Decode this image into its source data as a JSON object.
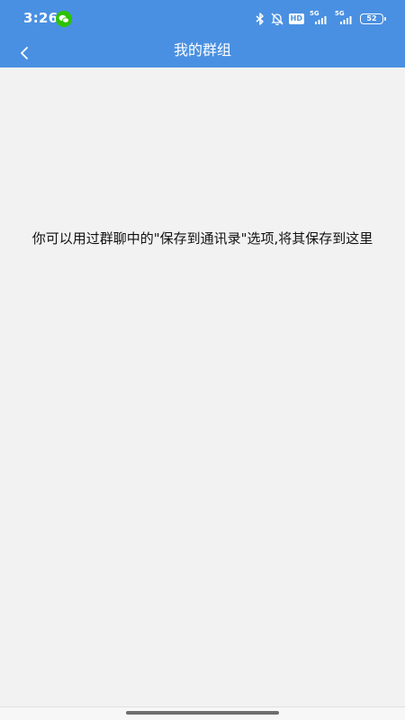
{
  "status_bar": {
    "time": "3:26",
    "hd_label": "HD",
    "network_1": "5G",
    "network_2": "5G",
    "battery": "52"
  },
  "header": {
    "title": "我的群组",
    "back_icon": "chevron-left-icon"
  },
  "main": {
    "empty_message": "你可以用过群聊中的\"保存到通讯录\"选项,将其保存到这里"
  },
  "colors": {
    "primary": "#4a90e2",
    "background": "#f2f2f2",
    "wechat": "#2dc100"
  }
}
